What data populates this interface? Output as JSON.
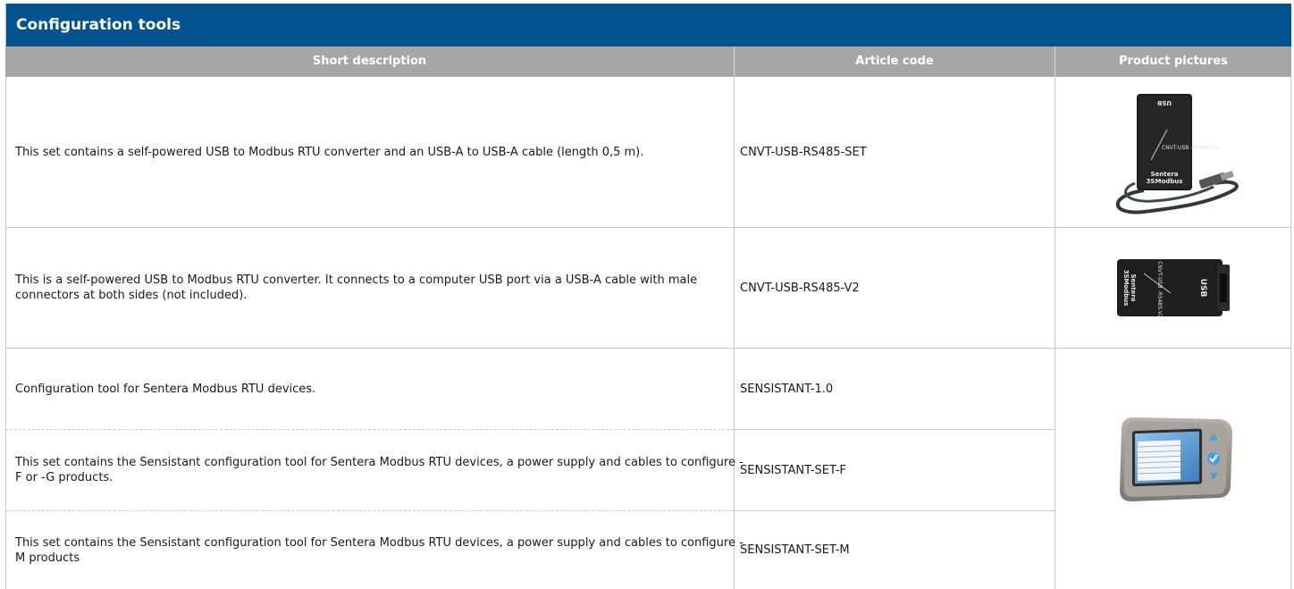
{
  "section": {
    "title": "Configuration tools"
  },
  "table": {
    "headers": [
      "Short description",
      "Article code",
      "Product pictures"
    ],
    "rows": [
      {
        "description": "This set contains a self-powered USB to Modbus RTU converter and an USB-A to USB-A cable (length 0,5 m).",
        "article_code": "CNVT-USB-RS485-SET"
      },
      {
        "description": "This is a self-powered USB to Modbus RTU converter. It connects to a computer USB port via a USB-A cable with male connectors at both sides (not included).",
        "article_code": "CNVT-USB-RS485-V2"
      },
      {
        "description": "Configuration tool for Sentera Modbus RTU devices.",
        "article_code": "SENSISTANT-1.0"
      },
      {
        "description": "This set contains the Sensistant configuration tool for Sentera Modbus RTU devices, a power supply and cables to configure -F or -G products.",
        "article_code": "SENSISTANT-SET-F"
      },
      {
        "description": "This set contains the Sensistant configuration tool for Sentera Modbus RTU devices, a power supply and cables to configure -M products",
        "article_code": "SENSISTANT-SET-M"
      }
    ]
  },
  "pictures": {
    "converter_set": {
      "label_top": "USB",
      "label_model": "CNVT-USB -RS485-V2",
      "label_brand": "Sentera",
      "label_sub": "3SModbus"
    },
    "converter": {
      "label_top": "USB",
      "label_model": "CNVT-USB -RS485-V2",
      "label_brand": "Sentera",
      "label_sub": "3SModbus"
    }
  },
  "colors": {
    "title_bar": "#035391",
    "header_row": "#a6a6a6",
    "grid": "#c8c8c8"
  }
}
